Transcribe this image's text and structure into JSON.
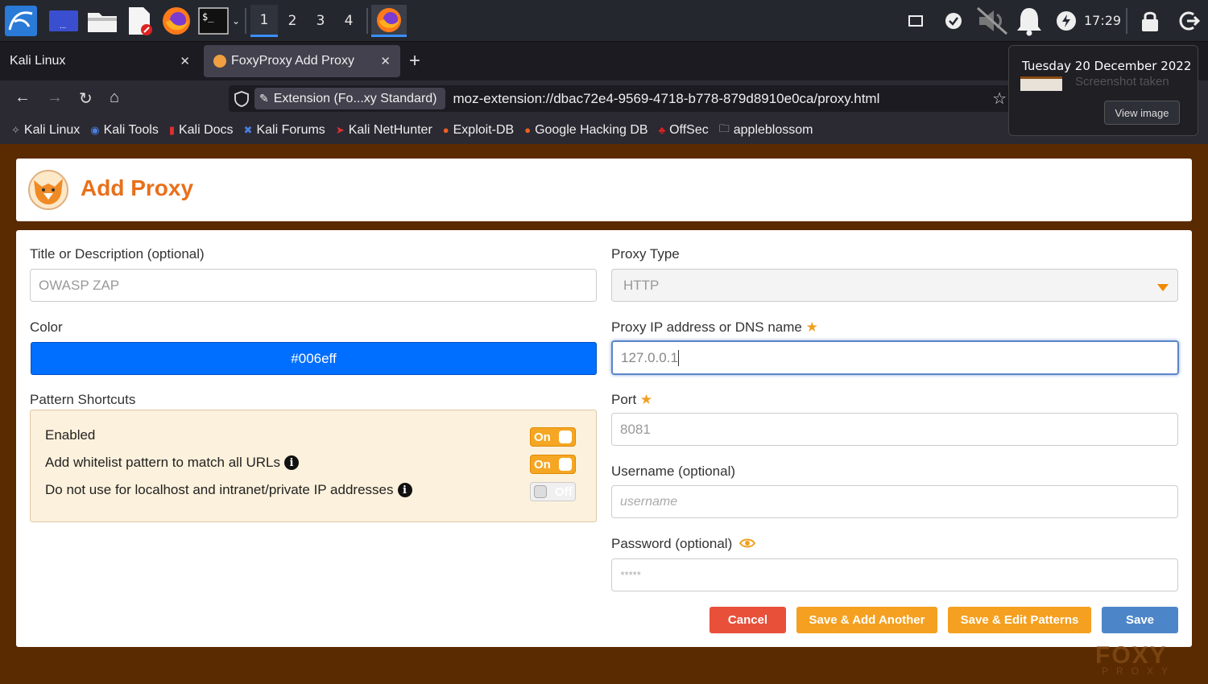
{
  "taskbar": {
    "workspaces": [
      "1",
      "2",
      "3",
      "4"
    ],
    "active_workspace": "1",
    "clock": "17:29"
  },
  "browser": {
    "tabs": [
      {
        "label": "Kali Linux",
        "active": false
      },
      {
        "label": "FoxyProxy Add Proxy",
        "active": true
      }
    ],
    "url_chip": "Extension (Fo...xy Standard)",
    "url": "moz-extension://dbac72e4-9569-4718-b778-879d8910e0ca/proxy.html",
    "bookmarks": [
      "Kali Linux",
      "Kali Tools",
      "Kali Docs",
      "Kali Forums",
      "Kali NetHunter",
      "Exploit-DB",
      "Google Hacking DB",
      "OffSec",
      "appleblossom"
    ]
  },
  "notification": {
    "title": "Tuesday 20 December 2022",
    "subtitle": "Screenshot taken",
    "button": "View image"
  },
  "page": {
    "title": "Add Proxy",
    "title_color": "#e8701a",
    "left": {
      "title_label": "Title or Description (optional)",
      "title_value": "OWASP ZAP",
      "color_label": "Color",
      "color_value": "#006eff",
      "pattern_label": "Pattern Shortcuts",
      "patterns": [
        {
          "label": "Enabled",
          "info": false,
          "state": "On"
        },
        {
          "label": "Add whitelist pattern to match all URLs",
          "info": true,
          "state": "On"
        },
        {
          "label": "Do not use for localhost and intranet/private IP addresses",
          "info": true,
          "state": "Off"
        }
      ]
    },
    "right": {
      "type_label": "Proxy Type",
      "type_value": "HTTP",
      "ip_label": "Proxy IP address or DNS name",
      "ip_value": "127.0.0.1",
      "port_label": "Port",
      "port_value": "8081",
      "username_label": "Username (optional)",
      "username_placeholder": "username",
      "password_label": "Password (optional)",
      "password_placeholder": "*****"
    },
    "buttons": {
      "cancel": "Cancel",
      "save_add_another": "Save & Add Another",
      "save_edit_patterns": "Save & Edit Patterns",
      "save": "Save"
    },
    "watermark": "FOXY",
    "watermark_sub": "PROXY"
  }
}
